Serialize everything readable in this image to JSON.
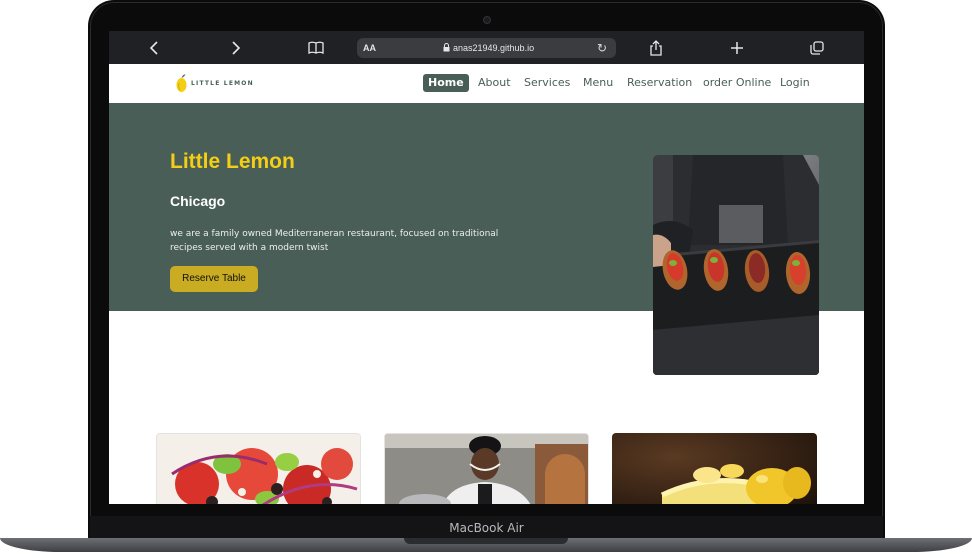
{
  "device": {
    "label": "MacBook Air"
  },
  "browser": {
    "text_size_label": "AA",
    "url": "anas21949.github.io",
    "icons": [
      "back-icon",
      "forward-icon",
      "bookmarks-icon",
      "reload-icon",
      "share-icon",
      "new-tab-icon",
      "tabs-icon",
      "lock-icon"
    ]
  },
  "site": {
    "logo_text": "LITTLE LEMON",
    "nav": {
      "home": "Home",
      "about": "About",
      "services": "Services",
      "menu": "Menu",
      "reservation": "Reservation",
      "order": "order Online",
      "login": "Login"
    },
    "hero": {
      "title": "Little Lemon",
      "subtitle": "Chicago",
      "description": "we are a family owned Mediterraneran restaurant, focused on traditional recipes served with a modern twist",
      "cta": "Reserve Table"
    },
    "colors": {
      "primary_green": "#495e57",
      "primary_yellow": "#f4ce14",
      "button_yellow": "#c9ac22"
    }
  }
}
